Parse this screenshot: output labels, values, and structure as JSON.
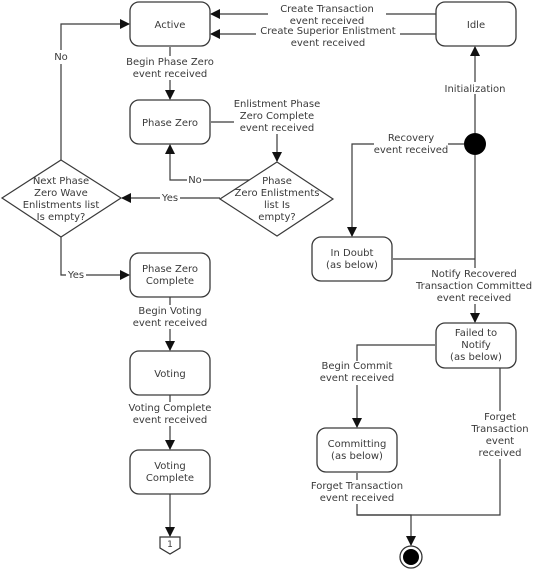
{
  "diagram": {
    "type": "state-machine",
    "states": {
      "active": "Active",
      "idle": "Idle",
      "phase_zero": "Phase Zero",
      "phase_zero_complete": [
        "Phase Zero",
        "Complete"
      ],
      "voting": "Voting",
      "voting_complete": [
        "Voting",
        "Complete"
      ],
      "in_doubt": [
        "In Doubt",
        "(as below)"
      ],
      "failed_to_notify": [
        "Failed to",
        "Notify",
        "(as below)"
      ],
      "committing": [
        "Committing",
        "(as below)"
      ]
    },
    "decisions": {
      "next_wave_empty": [
        "Next Phase",
        "Zero Wave",
        "Enlistments list",
        "Is empty?"
      ],
      "enlistments_empty": [
        "Phase",
        "Zero Enlistments",
        "list Is",
        "empty?"
      ]
    },
    "connector": {
      "label": "1"
    },
    "transitions": {
      "create_transaction": [
        "Create Transaction",
        "event received"
      ],
      "create_superior": [
        "Create Superior Enlistment",
        "event received"
      ],
      "initialization": "Initialization",
      "recovery": [
        "Recovery",
        "event received"
      ],
      "begin_phase_zero": [
        "Begin Phase Zero",
        "event received"
      ],
      "enlistment_phase_zero_complete": [
        "Enlistment Phase",
        "Zero Complete",
        "event received"
      ],
      "no_to_phase_zero": "No",
      "yes_to_next_wave": "Yes",
      "no_to_active": "No",
      "yes_to_phase_zero_complete": "Yes",
      "begin_voting": [
        "Begin Voting",
        "event received"
      ],
      "voting_complete": [
        "Voting Complete",
        "event received"
      ],
      "notify_recovered": [
        "Notify Recovered",
        "Transaction Committed",
        "event received"
      ],
      "begin_commit": [
        "Begin Commit",
        "event received"
      ],
      "forget_from_failed": [
        "Forget",
        "Transaction",
        "event",
        "received"
      ],
      "forget_from_committing": [
        "Forget Transaction",
        "event received"
      ]
    },
    "colors": {
      "stroke": "#3a3a3a",
      "fill": "#ffffff",
      "pseudo_state": "#000000"
    }
  }
}
